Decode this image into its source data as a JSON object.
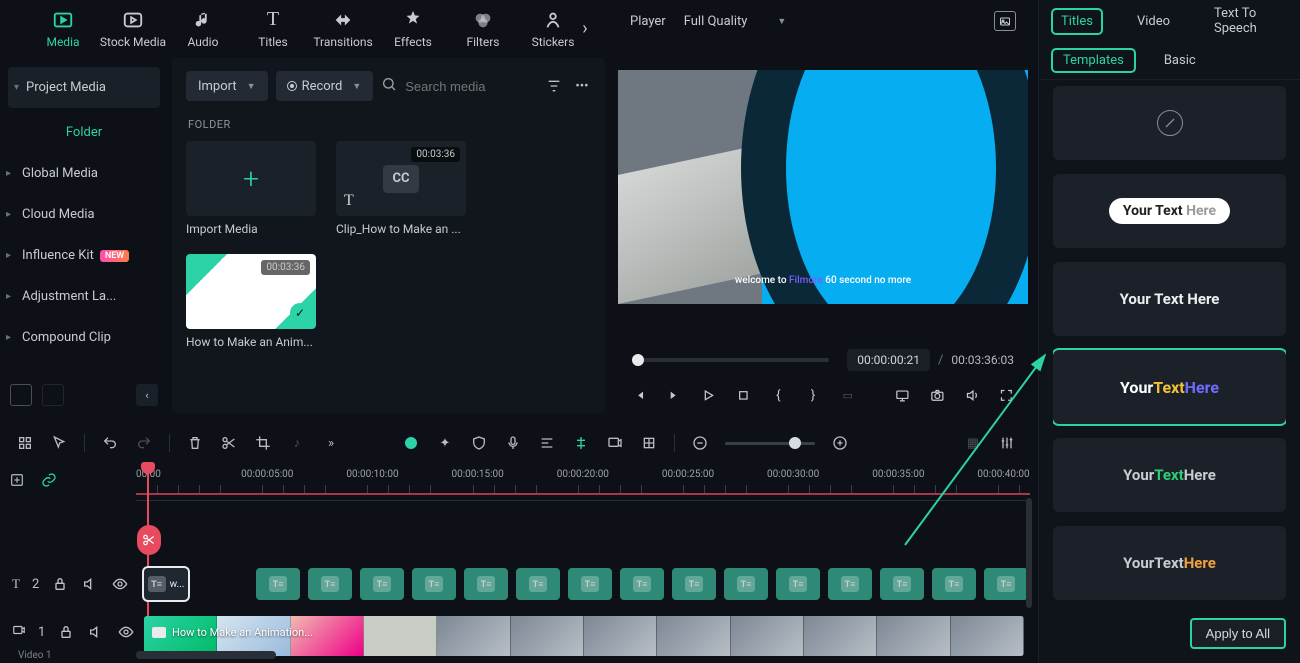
{
  "topbar": {
    "items": [
      {
        "label": "Media",
        "active": true
      },
      {
        "label": "Stock Media"
      },
      {
        "label": "Audio"
      },
      {
        "label": "Titles"
      },
      {
        "label": "Transitions"
      },
      {
        "label": "Effects"
      },
      {
        "label": "Filters"
      },
      {
        "label": "Stickers"
      }
    ]
  },
  "sidebar": {
    "project": "Project Media",
    "folder": "Folder",
    "items": [
      {
        "label": "Global Media"
      },
      {
        "label": "Cloud Media"
      },
      {
        "label": "Influence Kit",
        "badge": "NEW"
      },
      {
        "label": "Adjustment La..."
      },
      {
        "label": "Compound Clip"
      }
    ]
  },
  "media": {
    "import_label": "Import",
    "record_label": "Record",
    "search_placeholder": "Search media",
    "folder_heading": "FOLDER",
    "cards": [
      {
        "kind": "import",
        "caption": "Import Media"
      },
      {
        "kind": "cc",
        "duration": "00:03:36",
        "caption": "Clip_How to Make an ..."
      },
      {
        "kind": "video",
        "duration": "00:03:36",
        "caption": "How to Make an Anim..."
      }
    ]
  },
  "player": {
    "label": "Player",
    "quality": "Full Quality",
    "caption_pre": "welcome to ",
    "caption_hl": "Filmora",
    "caption_post": " 60 second no more",
    "current": "00:00:00:21",
    "sep": "/",
    "total": "00:03:36:03"
  },
  "ruler": {
    "marks": [
      "00:00",
      "00:00:05:00",
      "00:00:10:00",
      "00:00:15:00",
      "00:00:20:00",
      "00:00:25:00",
      "00:00:30:00",
      "00:00:35:00",
      "00:00:40:00"
    ]
  },
  "tracks": {
    "title_row": {
      "icon": "T",
      "count": "2"
    },
    "video_row": {
      "icon": "V",
      "count": "1",
      "label": "Video 1"
    },
    "video_clip_label": "How to Make an Animation..."
  },
  "right": {
    "tabs": [
      {
        "label": "Titles",
        "active": true
      },
      {
        "label": "Video"
      },
      {
        "label": "Text To Speech"
      }
    ],
    "subtabs": [
      {
        "label": "Templates",
        "active": true
      },
      {
        "label": "Basic"
      }
    ],
    "cards": {
      "pill_a": "Your Text ",
      "pill_b": "Here",
      "plain": "Your Text Here",
      "rainbow_a": "Your ",
      "rainbow_b": "Text ",
      "rainbow_c": "Here",
      "green_a": "Your ",
      "green_b": "Text ",
      "green_c": "Here",
      "orange_a": "Your ",
      "orange_b": "Text ",
      "orange_c": "Here"
    },
    "apply": "Apply to All"
  }
}
